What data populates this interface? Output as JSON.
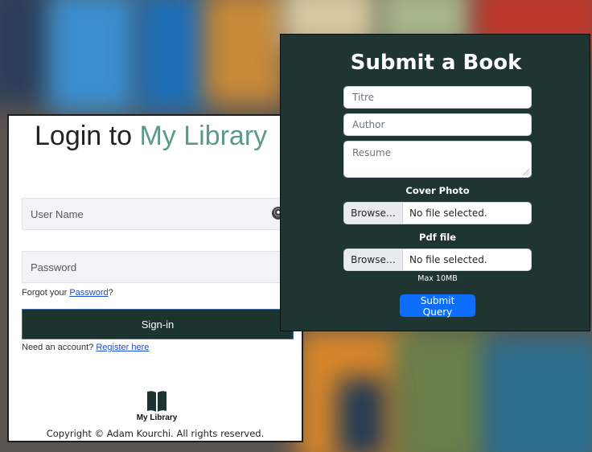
{
  "login": {
    "title_prefix": "Login to ",
    "title_brand": "My Library",
    "username_placeholder": "User Name",
    "password_placeholder": "Password",
    "forgot_prefix": "Forgot your ",
    "forgot_link": "Password",
    "forgot_suffix": "?",
    "signin_label": "Sign-in",
    "need_account": "Need an account? ",
    "register_link": "Register here",
    "footer_brand": "My Library",
    "copyright": "Copyright © Adam Kourchi. All rights reserved."
  },
  "submit": {
    "title": "Submit a Book",
    "titre_placeholder": "Titre",
    "author_placeholder": "Author",
    "resume_placeholder": "Resume",
    "cover_label": "Cover Photo",
    "pdf_label": "Pdf file",
    "browse_label": "Browse…",
    "no_file": "No file selected.",
    "max_size": "Max 10MB",
    "submit_label": "Submit Query"
  },
  "icons": {
    "password_toggle": "eye-toggle-icon",
    "footer_logo": "open-book-icon"
  },
  "colors": {
    "brand_accent": "#5b9a8b",
    "dark_panel": "#1f3531",
    "signin_bg": "#1d3330",
    "submit_button": "#0d6efd",
    "link": "#1a4fd4"
  }
}
